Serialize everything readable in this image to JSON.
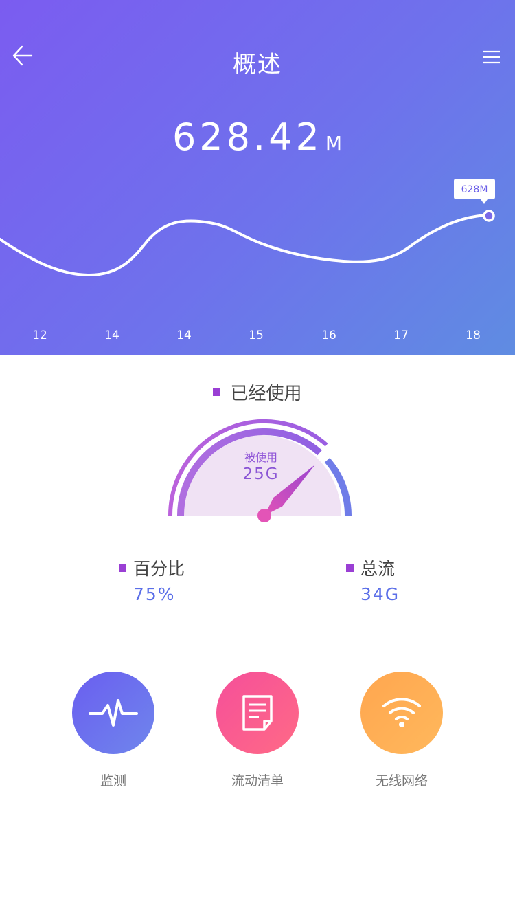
{
  "header": {
    "title": "概述",
    "value": "628.42",
    "unit": "M",
    "tooltip": "628M",
    "gradient": [
      "#7b5cf0",
      "#5f8ce2"
    ]
  },
  "chart_data": {
    "type": "line",
    "x": [
      "12",
      "14",
      "14",
      "15",
      "16",
      "17",
      "18"
    ],
    "annotation": "628M",
    "grid": false
  },
  "usage": {
    "legend": "已经使用",
    "gauge_label": "被使用",
    "gauge_value": "25G",
    "fraction": 0.75
  },
  "stats": [
    {
      "label": "百分比",
      "value": "75%"
    },
    {
      "label": "总流",
      "value": "34G"
    }
  ],
  "actions": [
    {
      "label": "监测",
      "icon": "pulse-icon",
      "colors": [
        "#6a5ef0",
        "#6f86ec"
      ]
    },
    {
      "label": "流动清单",
      "icon": "document-icon",
      "colors": [
        "#f54f9a",
        "#ff6a86"
      ]
    },
    {
      "label": "无线网络",
      "icon": "wifi-icon",
      "colors": [
        "#ffa64f",
        "#ffb85c"
      ]
    }
  ],
  "icons": {
    "back": "arrow-left-icon",
    "menu": "menu-icon"
  }
}
